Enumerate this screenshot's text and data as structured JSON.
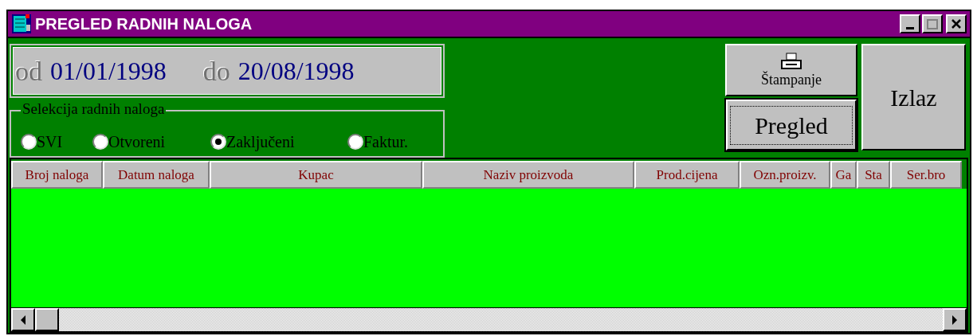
{
  "window": {
    "title": "PREGLED RADNIH NALOGA"
  },
  "date_range": {
    "from_label": "od",
    "from": "01/01/1998",
    "to_label": "do",
    "to": "20/08/1998"
  },
  "selection": {
    "title": "Selekcija radnih naloga",
    "options": [
      {
        "label": "SVI",
        "selected": false
      },
      {
        "label": "Otvoreni",
        "selected": false
      },
      {
        "label": "Zaključeni",
        "selected": true
      },
      {
        "label": "Faktur.",
        "selected": false
      }
    ]
  },
  "buttons": [
    {
      "kind": "print",
      "label": "Štampanje",
      "focused": false
    },
    {
      "kind": "view",
      "label": "Pregled",
      "focused": true
    },
    {
      "kind": "exit",
      "label": "Izlaz",
      "focused": false
    }
  ],
  "table": {
    "columns": [
      "Broj naloga",
      "Datum naloga",
      "Kupac",
      "Naziv proizvoda",
      "Prod.cijena",
      "Ozn.proizv.",
      "Ga",
      "Sta",
      "Ser.bro"
    ]
  }
}
